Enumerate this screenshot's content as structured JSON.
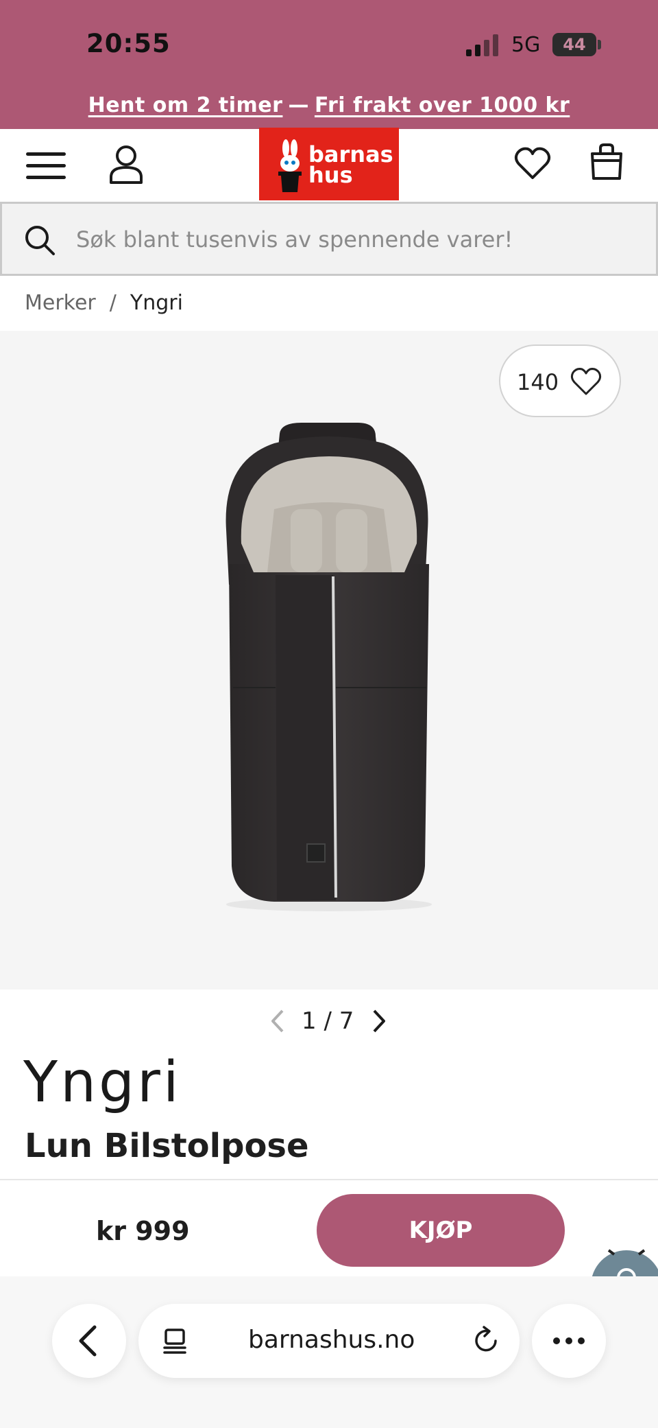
{
  "status_bar": {
    "time": "20:55",
    "network": "5G",
    "battery": "44"
  },
  "promo": {
    "pickup": "Hent om 2 timer",
    "separator": "—",
    "shipping": "Fri frakt over 1000 kr"
  },
  "header": {
    "logo_line1": "barnas",
    "logo_line2": "hus",
    "menu_icon": "hamburger-menu-icon",
    "user_icon": "user-icon",
    "wishlist_icon": "heart-icon",
    "cart_icon": "shopping-bag-icon"
  },
  "search": {
    "placeholder": "Søk blant tusenvis av spennende varer!"
  },
  "breadcrumb": {
    "items": [
      "Merker",
      "Yngri"
    ],
    "separator": "/"
  },
  "gallery": {
    "likes": "140",
    "pager": "1 / 7"
  },
  "product": {
    "brand": "Yngri",
    "name": "Lun Bilstolpose",
    "price": "kr 999",
    "buy_label": "KJØP"
  },
  "browser": {
    "url": "barnashus.no"
  },
  "colors": {
    "accent": "#ad5874",
    "logo_red": "#e2231a"
  }
}
